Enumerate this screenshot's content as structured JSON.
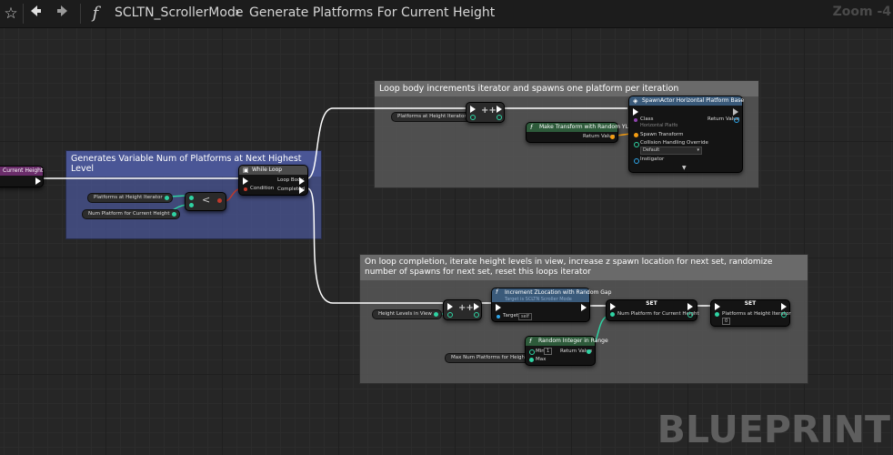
{
  "toolbar": {
    "breadcrumb_function": "SCLTN_ScrollerMode",
    "breadcrumb_separator": "›",
    "breadcrumb_graph": "Generate Platforms For Current Height",
    "zoom": "Zoom -4",
    "icons": [
      "star-icon",
      "back-arrow-icon",
      "forward-arrow-icon",
      "function-icon"
    ]
  },
  "comments": {
    "left": "Generates Variable Num of Platforms at Next Highest Level",
    "loop_body": "Loop body increments iterator and spawns one platform per iteration",
    "completion": "On loop completion, iterate height levels in view, increase z spawn location for next set, randomize number of spawns for next set, reset this loops iterator"
  },
  "entry_node": {
    "label": "Current Height"
  },
  "vars": {
    "platforms_iter_left": "Platforms at Height Iterator",
    "num_platforms_left": "Num Platform for Current Height",
    "platforms_iter_top": "Platforms at Height Iterator",
    "height_levels": "Height Levels in View",
    "max_num_platforms": "Max Num Platforms for Height"
  },
  "less_node": {
    "op": "<"
  },
  "while_loop": {
    "title": "While Loop",
    "condition": "Condition",
    "loop_body": "Loop Body",
    "completed": "Completed"
  },
  "incr_node_top": {
    "op": "++"
  },
  "incr_node_bottom": {
    "op": "++"
  },
  "make_transform": {
    "title": "Make Transform with Random YLoc",
    "return": "Return Value"
  },
  "spawn_actor": {
    "title": "SpawnActor Horizontal Platform Base",
    "class": "Class",
    "class_value": "Horizontal Platfo",
    "return": "Return Value",
    "spawn_transform": "Spawn Transform",
    "collision": "Collision Handling Override",
    "collision_value": "Default",
    "instigator": "Instigator"
  },
  "increment_z": {
    "title": "Increment ZLocation with Random Gap",
    "subtitle": "Target is SCLTN Scroller Mode",
    "target": "Target",
    "target_value": "self"
  },
  "set_num": {
    "title": "SET",
    "pin": "Num Platform for Current Height"
  },
  "set_iter": {
    "title": "SET",
    "pin": "Platforms at Height Iterator",
    "value": "0"
  },
  "random_int": {
    "title": "Random Integer in Range",
    "min": "Min",
    "min_value": "1",
    "max": "Max",
    "return": "Return Value"
  },
  "watermark": "BLUEPRINT",
  "colors": {
    "exec": "#ffffff",
    "int_pin": "#2fd3a3",
    "struct_pin": "#f39c12",
    "object_pin": "#2ea5e8",
    "bool_pin": "#c0392b",
    "comment_blue": "#4a5696",
    "comment_gray": "#5a5a5a",
    "function_header": "#3a5a7a",
    "pure_header": "#2d5a3a"
  }
}
